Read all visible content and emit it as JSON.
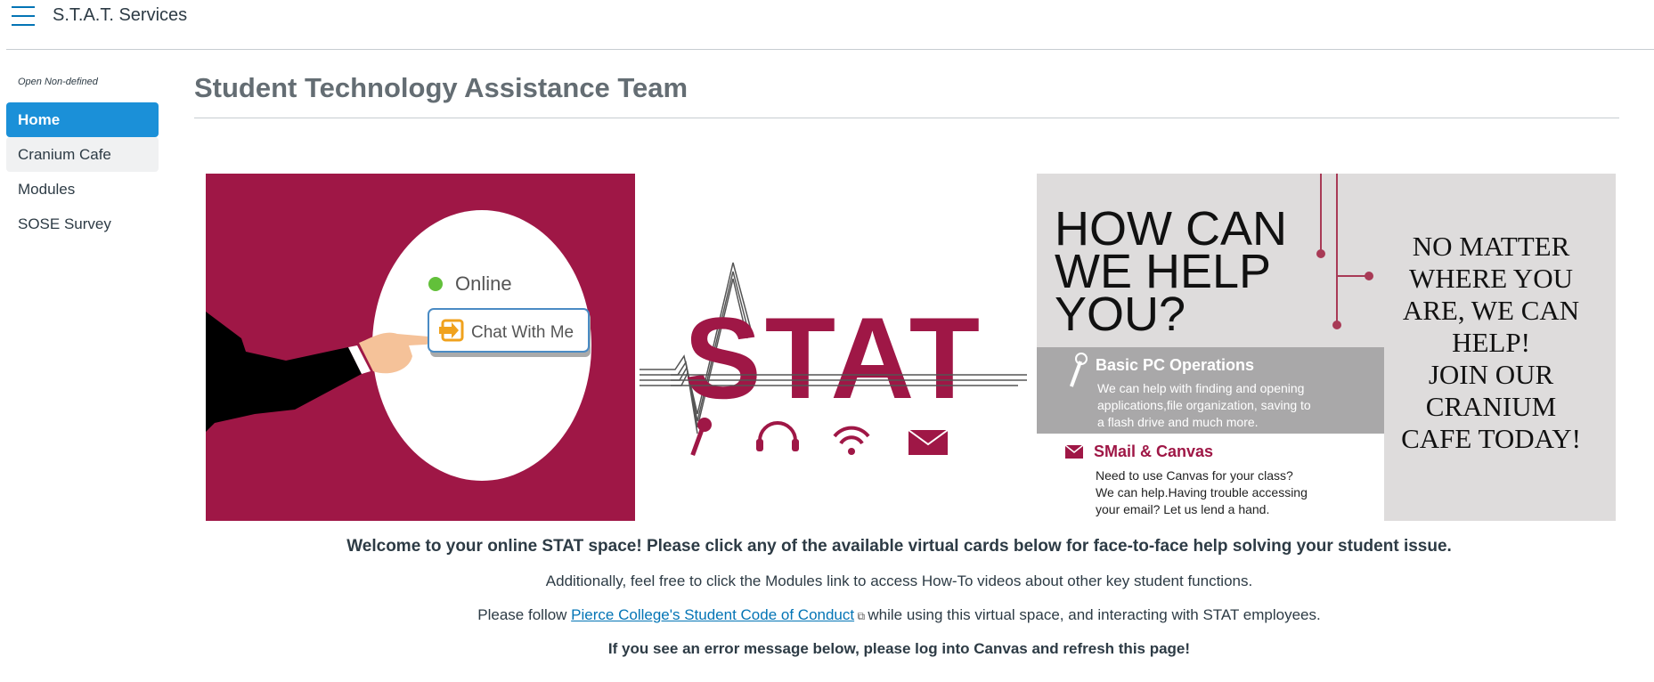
{
  "header": {
    "course_title": "S.T.A.T. Services",
    "menu_icon": "hamburger-icon"
  },
  "sidebar": {
    "subtitle": "Open Non-defined",
    "items": [
      {
        "label": "Home"
      },
      {
        "label": "Cranium Cafe"
      },
      {
        "label": "Modules"
      },
      {
        "label": "SOSE Survey"
      }
    ]
  },
  "main": {
    "page_title": "Student Technology Assistance Team",
    "banner": {
      "panel1": {
        "status": "Online",
        "chat_button": "Chat With Me"
      },
      "panel2": {
        "logo": "STAT"
      },
      "panel3": {
        "headline_1": "HOW CAN",
        "headline_2": "WE HELP",
        "headline_3": "YOU?",
        "pc_title": "Basic PC Operations",
        "pc_text_1": "We can help with finding and opening",
        "pc_text_2": "applications,file organization, saving to",
        "pc_text_3": "a flash drive and much more.",
        "smail_title": "SMail & Canvas",
        "smail_text_1": "Need to use Canvas for your class?",
        "smail_text_2": "We can help.Having trouble accessing",
        "smail_text_3": "your email? Let us lend a hand.",
        "side_1": "NO MATTER",
        "side_2": "WHERE YOU",
        "side_3": "ARE, WE CAN",
        "side_4": "HELP!",
        "side_5": "JOIN OUR",
        "side_6": "CRANIUM",
        "side_7": "CAFE TODAY!"
      }
    },
    "welcome": "Welcome to your online STAT space! Please click any of the available virtual cards below for face-to-face help solving your student issue.",
    "line2": "Additionally, feel free to click the Modules link to access How-To videos about other key student functions.",
    "line3_pre": "Please follow ",
    "line3_link": "Pierce College's Student Code of Conduct",
    "line3_post": " while using this virtual space, and interacting with STAT employees.",
    "line4": "If you see an error message below, please log into Canvas and refresh this page!"
  },
  "colors": {
    "accent": "#1b90d8",
    "brand": "#9f1746",
    "link": "#0374b5"
  }
}
